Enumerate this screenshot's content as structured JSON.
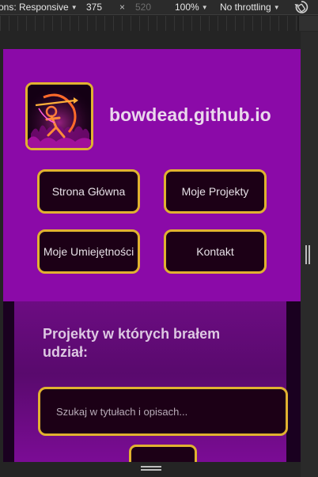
{
  "devtools": {
    "device_label": "ons: Responsive",
    "width_value": "375",
    "times_glyph": "×",
    "height_value": "520",
    "zoom": "100%",
    "throttling": "No throttling",
    "caret_glyph": "▼",
    "rotate_icon": "rotate-icon"
  },
  "site": {
    "title": "bowdead.github.io",
    "logo_icon": "archer-logo-icon",
    "nav": [
      {
        "label": "Strona Główna"
      },
      {
        "label": "Moje Projekty"
      },
      {
        "label": "Moje Umiejętności"
      },
      {
        "label": "Kontakt"
      }
    ],
    "section_title": "Projekty w których brałem udział:",
    "search_placeholder": "Szukaj w tytułach i opisach..."
  },
  "colors": {
    "header_bg": "#8b0aa8",
    "button_bg": "#1c0016",
    "accent_border": "#e0b230",
    "title_text": "#ead8ec",
    "page_bg": "#1a0120"
  }
}
